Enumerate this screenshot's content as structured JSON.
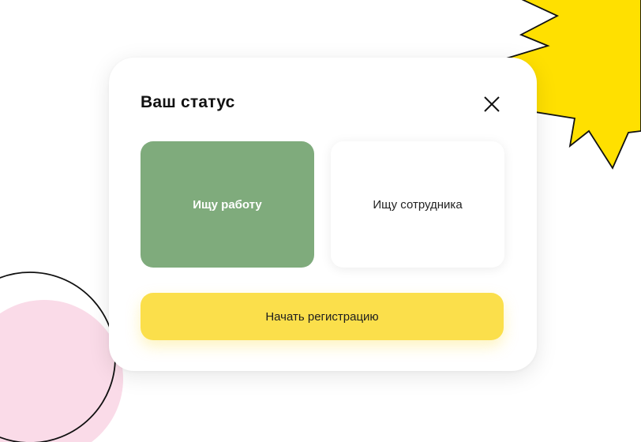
{
  "modal": {
    "title": "Ваш статус",
    "close_icon": "close-icon",
    "options": [
      {
        "label": "Ищу работу",
        "selected": true
      },
      {
        "label": "Ищу сотрудника",
        "selected": false
      }
    ],
    "submit_label": "Начать регистрацию"
  },
  "colors": {
    "selected_option": "#7fab7c",
    "primary_button": "#fbdf4b",
    "star_decoration": "#ffe000",
    "circle_decoration": "#fadbe8"
  }
}
